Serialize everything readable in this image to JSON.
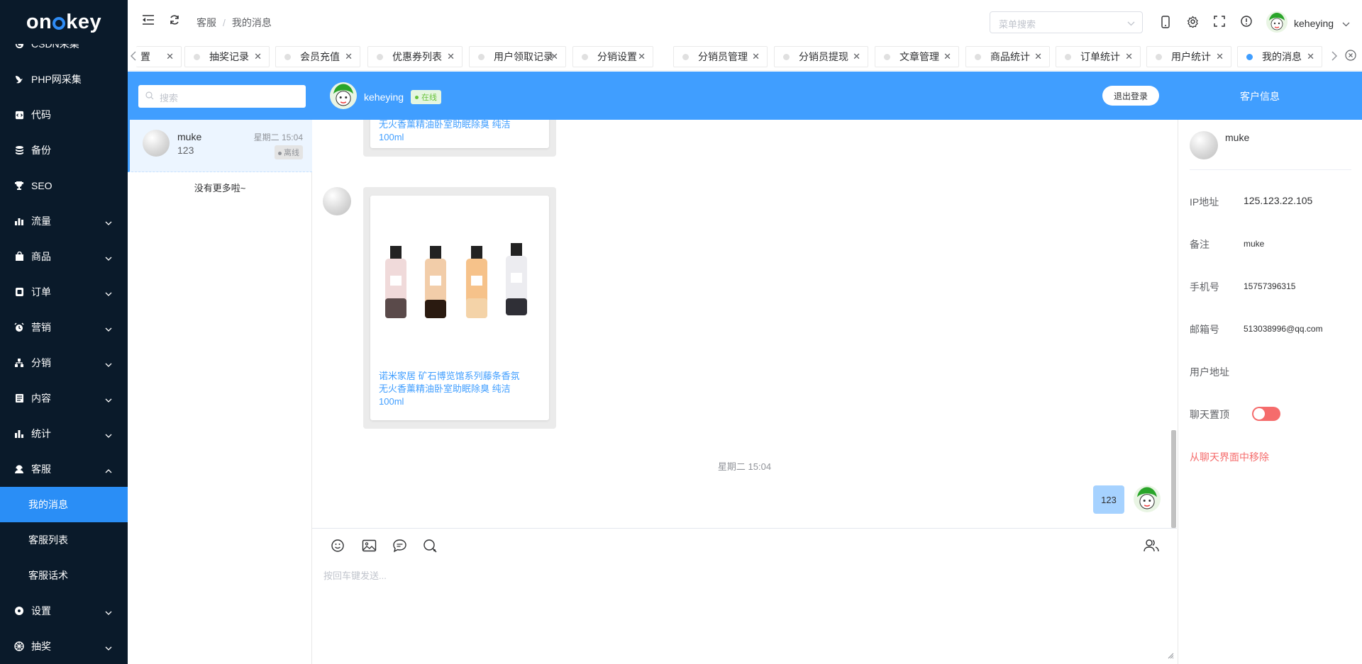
{
  "brand": {
    "logo": "onekey"
  },
  "sidebar": {
    "items": [
      {
        "label": "CSDN采集",
        "icon": "csdn-icon",
        "chevron": false
      },
      {
        "label": "PHP网采集",
        "icon": "bird-icon",
        "chevron": false
      },
      {
        "label": "代码",
        "icon": "code-icon",
        "chevron": false
      },
      {
        "label": "备份",
        "icon": "database-icon",
        "chevron": false
      },
      {
        "label": "SEO",
        "icon": "trophy-icon",
        "chevron": false
      },
      {
        "label": "流量",
        "icon": "bar-chart-icon",
        "chevron": true
      },
      {
        "label": "商品",
        "icon": "bag-icon",
        "chevron": true
      },
      {
        "label": "订单",
        "icon": "order-icon",
        "chevron": true
      },
      {
        "label": "营销",
        "icon": "alarm-icon",
        "chevron": true
      },
      {
        "label": "分销",
        "icon": "sitemap-icon",
        "chevron": true
      },
      {
        "label": "内容",
        "icon": "document-icon",
        "chevron": true
      },
      {
        "label": "统计",
        "icon": "stats-icon",
        "chevron": true
      },
      {
        "label": "客服",
        "icon": "support-icon",
        "chevron": true,
        "expanded": true
      },
      {
        "label": "我的消息",
        "sub": true,
        "active": true
      },
      {
        "label": "客服列表",
        "sub": true
      },
      {
        "label": "客服话术",
        "sub": true
      },
      {
        "label": "设置",
        "icon": "settings-icon",
        "chevron": true
      },
      {
        "label": "抽奖",
        "icon": "lottery-icon",
        "chevron": true
      }
    ]
  },
  "header": {
    "breadcrumb": [
      "客服",
      "我的消息"
    ],
    "menu_search_placeholder": "菜单搜索",
    "user": "keheying"
  },
  "tabs": [
    {
      "label": "设置",
      "partial": "置"
    },
    {
      "label": "抽奖记录"
    },
    {
      "label": "会员充值"
    },
    {
      "label": "优惠券列表"
    },
    {
      "label": "用户领取记录"
    },
    {
      "label": "分销设置"
    },
    {
      "label": "分销员管理"
    },
    {
      "label": "分销员提现"
    },
    {
      "label": "文章管理"
    },
    {
      "label": "商品统计"
    },
    {
      "label": "订单统计"
    },
    {
      "label": "用户统计"
    },
    {
      "label": "我的消息",
      "active": true
    }
  ],
  "chatbar": {
    "search_placeholder": "搜索",
    "agent_name": "keheying",
    "status": "在线",
    "logout": "退出登录",
    "customer_info": "客户信息"
  },
  "conversations": [
    {
      "name": "muke",
      "last_msg": "123",
      "time": "星期二 15:04",
      "status": "离线"
    }
  ],
  "no_more": "没有更多啦~",
  "messages": {
    "product_title_partial_1": "无火香薰精油卧室助眠除臭 纯洁",
    "product_title_partial_2": "100ml",
    "product_title": [
      "诺米家居 矿石博览馆系列藤条香氛",
      "无火香薰精油卧室助眠除臭 纯洁",
      "100ml"
    ],
    "time": "星期二 15:04",
    "my_msg": "123"
  },
  "input": {
    "placeholder": "按回车键发送..."
  },
  "customer": {
    "name": "muke",
    "fields": [
      {
        "label": "IP地址",
        "value": "125.123.22.105"
      },
      {
        "label": "备注",
        "value": "muke"
      },
      {
        "label": "手机号",
        "value": "15757396315"
      },
      {
        "label": "邮箱号",
        "value": "513038996@qq.com"
      },
      {
        "label": "用户地址",
        "value": ""
      }
    ],
    "pin_label": "聊天置顶",
    "pin_on": true,
    "remove": "从聊天界面中移除"
  }
}
